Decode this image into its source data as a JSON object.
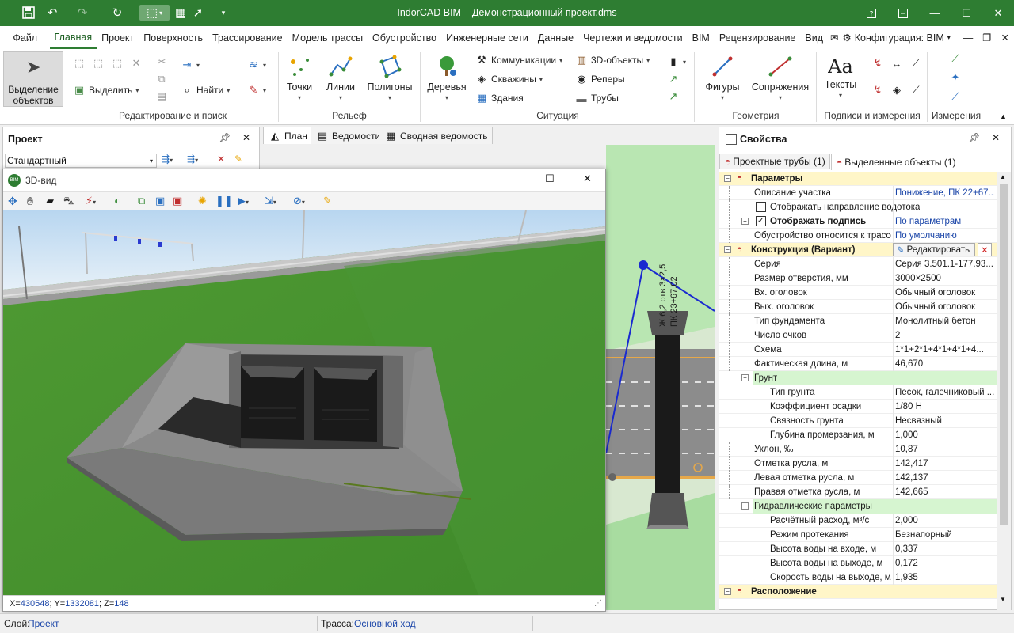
{
  "window": {
    "title": "IndorCAD BIM – Демонстрационный проект.dms"
  },
  "menu": {
    "items": [
      "Файл",
      "Главная",
      "Проект",
      "Поверхность",
      "Трассирование",
      "Модель трассы",
      "Обустройство",
      "Инженерные сети",
      "Данные",
      "Чертежи и ведомости",
      "BIM",
      "Рецензирование",
      "Вид"
    ],
    "config_label": "Конфигурация: BIM"
  },
  "ribbon": {
    "select_objects": "Выделение объектов",
    "select": "Выделить",
    "find": "Найти",
    "points": "Точки",
    "lines": "Линии",
    "polygons": "Полигоны",
    "trees": "Деревья",
    "communications": "Коммуникации",
    "wells": "Скважины",
    "buildings": "Здания",
    "objects3d": "3D-объекты",
    "benchmarks": "Реперы",
    "pipes": "Трубы",
    "figures": "Фигуры",
    "conjugations": "Сопряжения",
    "texts": "Тексты",
    "groups": {
      "edit_search": "Редактирование и поиск",
      "relief": "Рельеф",
      "situation": "Ситуация",
      "geometry": "Геометрия",
      "captions": "Подписи и измерения",
      "measurements": "Измерения"
    }
  },
  "project_panel": {
    "title": "Проект",
    "style_value": "Стандартный"
  },
  "view3d": {
    "title": "3D-вид",
    "coords": {
      "x_label": "X=",
      "x": "430548",
      "y_label": "; Y=",
      "y": "1332081",
      "z_label": "; Z=",
      "z": "148"
    }
  },
  "center_tabs": [
    "План",
    "Ведомости",
    "Сводная ведомость"
  ],
  "plan_labels": {
    "label1": "Ж 6,2 отв 3×2,5",
    "label2": "ПК 23+67.02"
  },
  "properties": {
    "title": "Свойства",
    "tabs": [
      "Проектные трубы (1)",
      "Выделенные объекты (1)"
    ],
    "edit_button": "Редактировать",
    "rows": [
      {
        "name": "Параметры",
        "value": "",
        "kind": "section"
      },
      {
        "name": "Описание участка",
        "value": "Понижение, ПК 22+67...",
        "kind": "row",
        "indent": 1,
        "link": true
      },
      {
        "name": "Отображать направление водотока",
        "value": "",
        "kind": "check",
        "indent": 1,
        "checked": false
      },
      {
        "name": "Отображать подпись",
        "value": "По параметрам",
        "kind": "checkbold",
        "indent": 1,
        "checked": true,
        "link": true
      },
      {
        "name": "Обустройство относится к трассе",
        "value": "По умолчанию",
        "kind": "row",
        "indent": 1,
        "link": true
      },
      {
        "name": "Конструкция (Вариант)",
        "value": "",
        "kind": "section-edit"
      },
      {
        "name": "Серия",
        "value": "Серия 3.501.1-177.93...",
        "kind": "row",
        "indent": 1
      },
      {
        "name": "Размер отверстия, мм",
        "value": "3000×2500",
        "kind": "row",
        "indent": 1
      },
      {
        "name": "Вх. оголовок",
        "value": "Обычный оголовок",
        "kind": "row",
        "indent": 1
      },
      {
        "name": "Вых. оголовок",
        "value": "Обычный оголовок",
        "kind": "row",
        "indent": 1
      },
      {
        "name": "Тип фундамента",
        "value": "Монолитный бетон",
        "kind": "row",
        "indent": 1
      },
      {
        "name": "Число очков",
        "value": "2",
        "kind": "row",
        "indent": 1
      },
      {
        "name": "Схема",
        "value": "1*1+2*1+4*1+4*1+4...",
        "kind": "row",
        "indent": 1
      },
      {
        "name": "Фактическая длина, м",
        "value": "46,670",
        "kind": "row",
        "indent": 1
      },
      {
        "name": "Грунт",
        "value": "",
        "kind": "subsection",
        "indent": 1
      },
      {
        "name": "Тип грунта",
        "value": "Песок, галечниковый ...",
        "kind": "row",
        "indent": 2
      },
      {
        "name": "Коэффициент осадки",
        "value": "1/80 Н",
        "kind": "row",
        "indent": 2
      },
      {
        "name": "Связность грунта",
        "value": "Несвязный",
        "kind": "row",
        "indent": 2
      },
      {
        "name": "Глубина промерзания, м",
        "value": "1,000",
        "kind": "row",
        "indent": 2
      },
      {
        "name": "Уклон, ‰",
        "value": "10,87",
        "kind": "row",
        "indent": 1
      },
      {
        "name": "Отметка русла, м",
        "value": "142,417",
        "kind": "row",
        "indent": 1
      },
      {
        "name": "Левая отметка русла, м",
        "value": "142,137",
        "kind": "row",
        "indent": 1
      },
      {
        "name": "Правая отметка русла, м",
        "value": "142,665",
        "kind": "row",
        "indent": 1
      },
      {
        "name": "Гидравлические параметры",
        "value": "",
        "kind": "subsection",
        "indent": 1
      },
      {
        "name": "Расчётный расход, м³/с",
        "value": "2,000",
        "kind": "row",
        "indent": 2
      },
      {
        "name": "Режим протекания",
        "value": "Безнапорный",
        "kind": "row",
        "indent": 2
      },
      {
        "name": "Высота воды на входе, м",
        "value": "0,337",
        "kind": "row",
        "indent": 2
      },
      {
        "name": "Высота воды на выходе, м",
        "value": "0,172",
        "kind": "row",
        "indent": 2
      },
      {
        "name": "Скорость воды на выходе, м/с",
        "value": "1,935",
        "kind": "row",
        "indent": 2
      },
      {
        "name": "Расположение",
        "value": "",
        "kind": "section"
      }
    ]
  },
  "status": {
    "layer_label": "Слой:",
    "layer_value": "Проект",
    "route_label": "Трасса:",
    "route_value": "Основной ход"
  }
}
